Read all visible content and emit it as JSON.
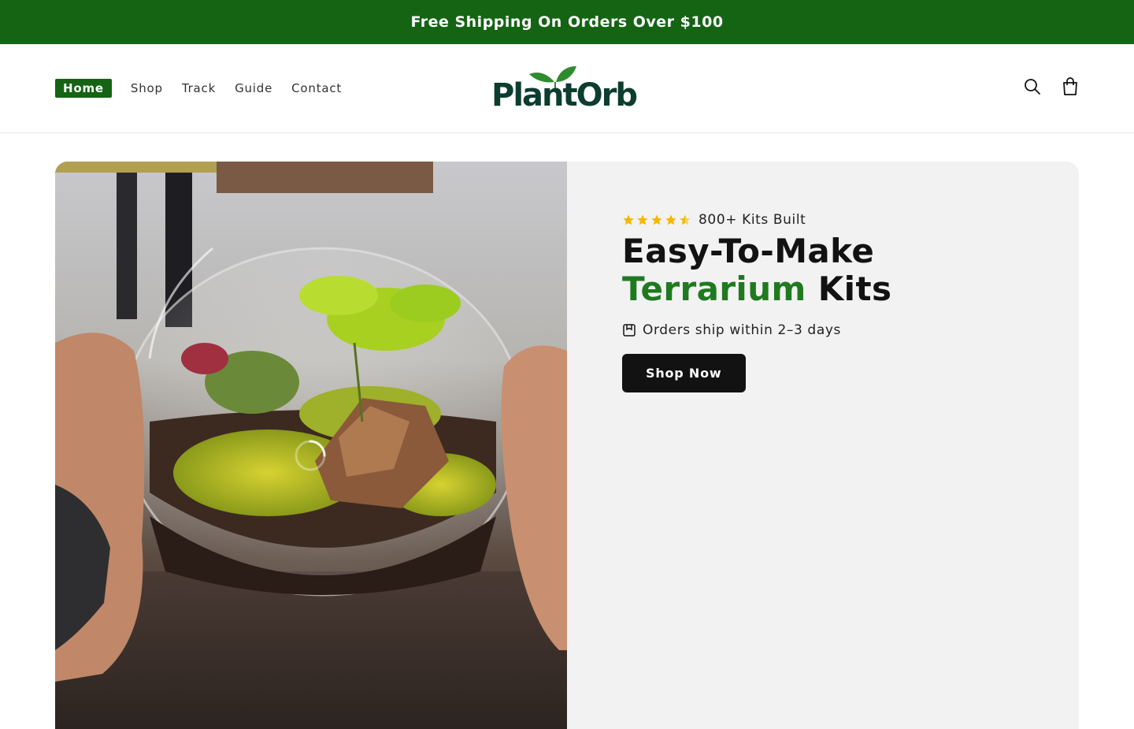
{
  "announcement": {
    "text": "Free Shipping On Orders Over $100"
  },
  "nav": {
    "items": [
      {
        "label": "Home",
        "active": true
      },
      {
        "label": "Shop"
      },
      {
        "label": "Track"
      },
      {
        "label": "Guide"
      },
      {
        "label": "Contact"
      }
    ]
  },
  "brand": {
    "name": "PlantOrb",
    "color": "#0d3d2e",
    "leaf_color": "#2e8b2e"
  },
  "header_icons": [
    "search-icon",
    "cart-icon"
  ],
  "hero": {
    "rating_stars": 4.5,
    "rating_text": "800+ Kits Built",
    "headline_line1": "Easy-To-Make",
    "headline_accent": "Terrarium",
    "headline_rest": "Kits",
    "shipping_text": "Orders ship within 2–3 days",
    "cta_label": "Shop Now",
    "media_icon": "loading-spinner-icon"
  },
  "colors": {
    "primary_green": "#146414",
    "accent_green": "#1f7a1f",
    "star": "#f5b800",
    "button_bg": "#121212",
    "panel_bg": "#f2f2f2"
  }
}
